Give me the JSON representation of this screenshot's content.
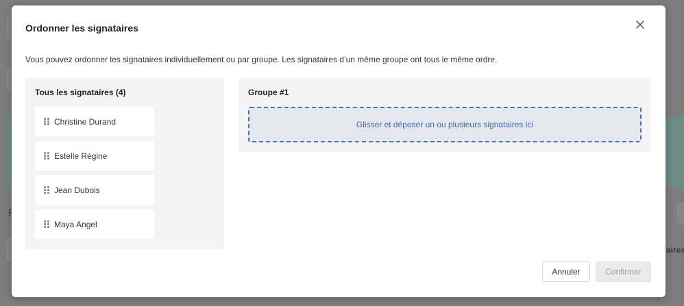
{
  "background": {
    "partial_text_right": "aires",
    "partial_text_left": "P"
  },
  "modal": {
    "title": "Ordonner les signataires",
    "description": "Vous pouvez ordonner les signataires individuellement ou par groupe. Les signataires d’un même groupe ont tous le même ordre.",
    "close_icon": "close-icon"
  },
  "signers_panel": {
    "title": "Tous les signataires (4)",
    "items": [
      {
        "name": "Christine Durand"
      },
      {
        "name": "Estelle Régine"
      },
      {
        "name": "Jean Dubois"
      },
      {
        "name": "Maya Angel"
      }
    ]
  },
  "group": {
    "title": "Groupe #1",
    "dropzone_text": "Glisser et déposer un ou plusieurs signataires ici"
  },
  "actions": {
    "cancel_label": "Annuler",
    "confirm_label": "Confirmer"
  },
  "colors": {
    "accent": "#3f66a8",
    "dropzone_border": "#4a72b8",
    "panel_bg": "#f4f4f4"
  }
}
